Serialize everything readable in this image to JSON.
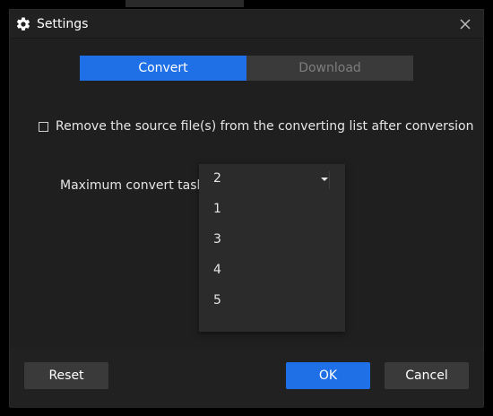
{
  "dialog": {
    "title": "Settings",
    "title_icon": "gear-icon",
    "close_icon": "close-icon"
  },
  "tabs": [
    {
      "label": "Convert",
      "active": true
    },
    {
      "label": "Download",
      "active": false
    }
  ],
  "convert": {
    "remove_source_label": "Remove the source file(s) from the converting list after conversion",
    "remove_source_checked": false,
    "max_tasks_label": "Maximum convert tasks",
    "max_tasks_selected": "2",
    "max_tasks_options": [
      "1",
      "3",
      "4",
      "5"
    ]
  },
  "footer": {
    "reset_label": "Reset",
    "ok_label": "OK",
    "cancel_label": "Cancel"
  },
  "colors": {
    "accent": "#1f6fe6",
    "background": "#212121",
    "button": "#3a3a3a"
  }
}
